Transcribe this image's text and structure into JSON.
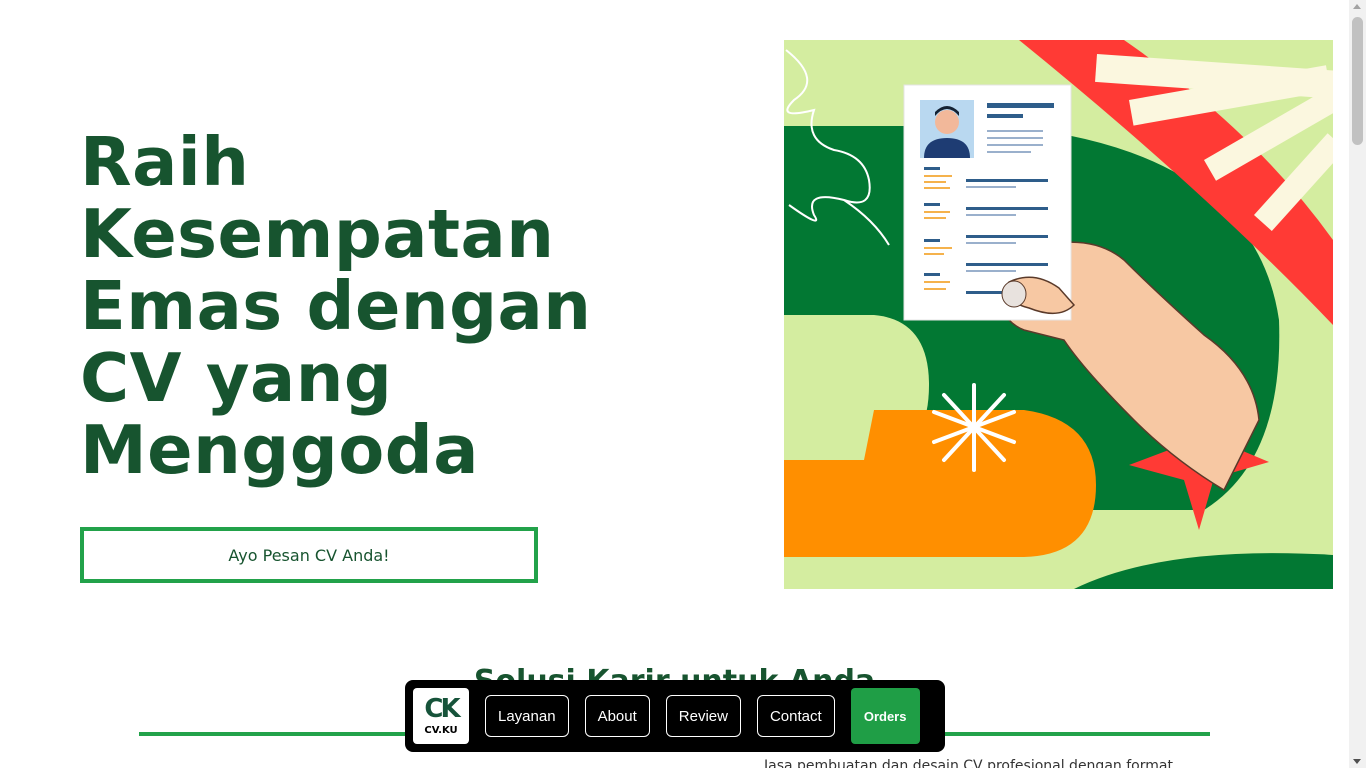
{
  "hero": {
    "title_lines": [
      "Raih",
      "Kesempatan",
      "Emas dengan",
      "CV yang",
      "Menggoda"
    ],
    "cta_label": "Ayo Pesan CV Anda!"
  },
  "section": {
    "heading": "Solusi Karir untuk Anda",
    "text": "Jasa pembuatan dan desain CV profesional dengan format"
  },
  "nav": {
    "logo_mark": "CK",
    "logo_text": "CV.KU",
    "items": [
      {
        "label": "Layanan"
      },
      {
        "label": "About"
      },
      {
        "label": "Review"
      },
      {
        "label": "Contact"
      }
    ],
    "orders_label": "Orders"
  },
  "colors": {
    "brand_green": "#17542f",
    "accent_green": "#22a24a",
    "light_green": "#d4eda0",
    "red": "#ff3a35",
    "orange": "#ff8f00"
  }
}
